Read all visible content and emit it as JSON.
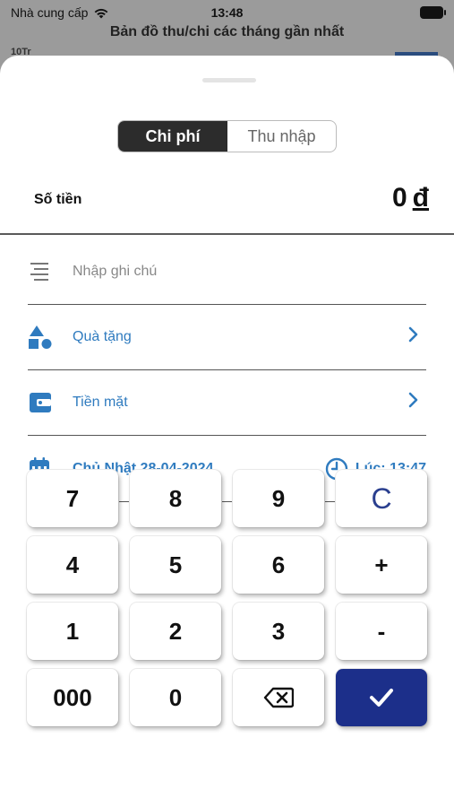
{
  "status_bar": {
    "carrier": "Nhà cung cấp",
    "time": "13:48"
  },
  "background": {
    "title": "Bản đồ thu/chi các tháng gần nhất",
    "axis_label": "10Tr"
  },
  "segment": {
    "options": [
      "Chi phí",
      "Thu nhập"
    ],
    "selected": "Chi phí"
  },
  "amount": {
    "label": "Số tiền",
    "value": "0",
    "currency": "đ"
  },
  "fields": {
    "note_placeholder": "Nhập ghi chú",
    "category": "Quà tặng",
    "wallet": "Tiền mặt",
    "date": "Chủ Nhật 28-04-2024",
    "time": "Lúc: 13:47"
  },
  "keypad": {
    "keys": [
      "7",
      "8",
      "9",
      "C",
      "4",
      "5",
      "6",
      "+",
      "1",
      "2",
      "3",
      "-",
      "000",
      "0"
    ]
  },
  "colors": {
    "accent": "#2f7bbf",
    "confirm": "#1c2f8a",
    "segment_active": "#2c2c2c"
  }
}
